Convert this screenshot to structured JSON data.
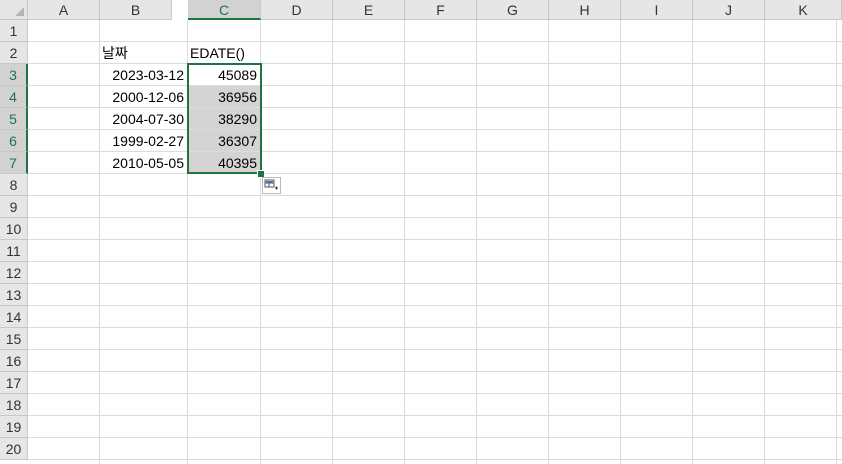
{
  "spreadsheet": {
    "columns": [
      "A",
      "B",
      "C",
      "D",
      "E",
      "F",
      "G",
      "H",
      "I",
      "J",
      "K"
    ],
    "rows": [
      "1",
      "2",
      "3",
      "4",
      "5",
      "6",
      "7",
      "8",
      "9",
      "10",
      "11",
      "12",
      "13",
      "14",
      "15",
      "16",
      "17",
      "18",
      "19",
      "20"
    ],
    "selected_column": "C",
    "selected_rows": [
      "3",
      "4",
      "5",
      "6",
      "7"
    ],
    "selected_range": "C3:C7",
    "cells": {
      "B2": "날짜",
      "C2": "EDATE()",
      "B3": "2023-03-12",
      "C3": "45089",
      "B4": "2000-12-06",
      "C4": "36956",
      "B5": "2004-07-30",
      "C5": "38290",
      "B6": "1999-02-27",
      "C6": "36307",
      "B7": "2010-05-05",
      "C7": "40395"
    },
    "colors": {
      "selection": "#217346",
      "header_bg": "#e6e6e6",
      "selected_header_bg": "#d2d2d2",
      "gridline": "#dadcdd",
      "shaded_cell": "#d4d4d4"
    },
    "quick_analysis_icon": "quick-analysis-icon"
  }
}
